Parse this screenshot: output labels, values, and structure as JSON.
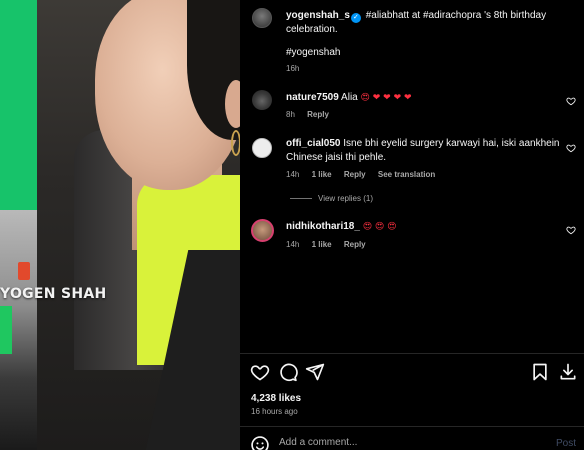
{
  "media": {
    "watermark": "YOGEN SHAH"
  },
  "post": {
    "owner": {
      "username": "yogenshah_s",
      "verified": true
    },
    "caption": "#aliabhatt at #adirachopra 's 8th birthday celebration.",
    "hashtag": "#yogenshah",
    "time": "16h"
  },
  "comments": [
    {
      "username": "nature7509",
      "text": "Alia",
      "emojis": "😍 ❤ ❤ ❤ ❤",
      "time": "8h",
      "reply_label": "Reply"
    },
    {
      "username": "offi_cial050",
      "text": "Isne bhi eyelid surgery karwayi hai, iski aankhein Chinese jaisi thi pehle.",
      "time": "14h",
      "likes": "1 like",
      "reply_label": "Reply",
      "translate_label": "See translation"
    },
    {
      "username": "nidhikothari18_",
      "text": "",
      "emojis": "😍 😍 😍",
      "time": "14h",
      "likes": "1 like",
      "reply_label": "Reply"
    }
  ],
  "view_replies": "View replies (1)",
  "stats": {
    "likes": "4,238 likes",
    "posted_ago": "16 hours ago"
  },
  "composer": {
    "placeholder": "Add a comment...",
    "post_label": "Post"
  },
  "icons": {
    "like": "heart-icon",
    "comment": "comment-icon",
    "share": "share-icon",
    "save": "bookmark-icon",
    "download": "download-icon",
    "emoji": "emoji-icon",
    "comment_like": "heart-small-icon"
  },
  "colors": {
    "background": "#000000",
    "text": "#f5f5f5",
    "muted": "#a8a8a8",
    "verified": "#0095f6",
    "heart_emoji": "#ff3040",
    "post_disabled": "#3f4b63"
  }
}
